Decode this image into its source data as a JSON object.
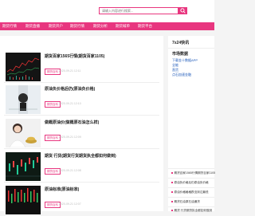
{
  "search": {
    "placeholder": "请输入内容进行搜索..."
  },
  "nav": {
    "items": [
      "期货行情",
      "期货直播",
      "期货开户",
      "期货行情",
      "期货分析",
      "期货喊单",
      "期货平台"
    ]
  },
  "articles": [
    {
      "title": "期货百家1565行情(期货百家1105)",
      "desc": "",
      "tag": "期货百科",
      "time": "2020-09-21 12:11"
    },
    {
      "title": "原油负价格后仍(原油负价格)",
      "desc": "",
      "tag": "期货百科",
      "time": "2020-09-21 12:10"
    },
    {
      "title": "做概原油价(做概原石油怎么样)",
      "desc": "",
      "tag": "期货百科",
      "time": "2020-09-21 12:09"
    },
    {
      "title": "期货 行货(期货行货期货执全都如何做到)",
      "desc": "",
      "tag": "期货百科",
      "time": "2020-09-21 12:08"
    },
    {
      "title": "原油标准(原油标准)",
      "desc": "",
      "tag": "期货百科",
      "time": "2020-09-21 12:07"
    }
  ],
  "sidebar": {
    "news_title": "7x24快讯",
    "market_title": "市场数据",
    "market_links": [
      "下载金十数据APP",
      "全能",
      "直货",
      "点石加速金融"
    ],
    "hot_items": [
      "期货百家1565行情期货百家1105",
      "原油负价格后仍原油负价格",
      "原油价格格格跌没到达最低",
      "期货石油原石油通货",
      "期货 行货期货执全都如何做到"
    ]
  }
}
